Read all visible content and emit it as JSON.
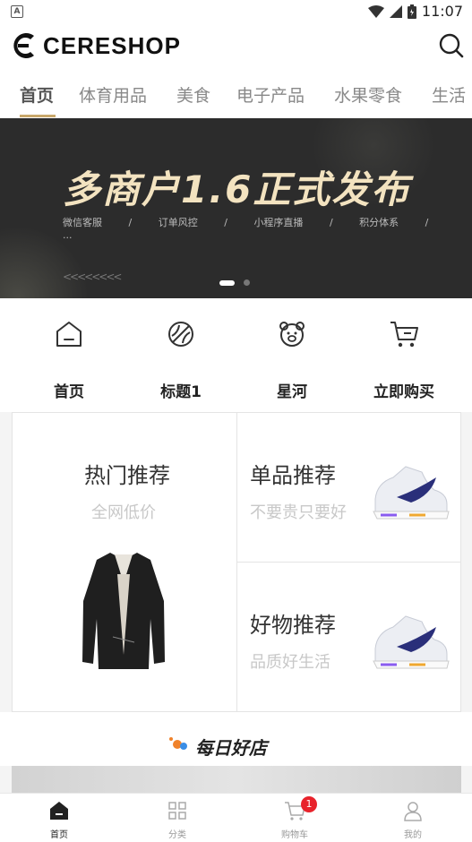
{
  "status_bar": {
    "time": "11:07",
    "app_icon_letter": "A"
  },
  "header": {
    "logo_text": "CERESHOP"
  },
  "tabs": [
    {
      "label": "首页",
      "active": true
    },
    {
      "label": "体育用品"
    },
    {
      "label": "美食"
    },
    {
      "label": "电子产品"
    },
    {
      "label": "水果零食"
    },
    {
      "label": "生活"
    }
  ],
  "banner": {
    "title": "多商户1.6正式发布",
    "features": [
      "微信客服",
      "/",
      "订单风控",
      "/",
      "小程序直播",
      "/",
      "积分体系",
      "/",
      "..."
    ],
    "arrows": "<<<<<<<<"
  },
  "nav_grid": [
    {
      "label": "首页",
      "icon": "home-icon"
    },
    {
      "label": "标题1",
      "icon": "ball-icon"
    },
    {
      "label": "星河",
      "icon": "bear-icon"
    },
    {
      "label": "立即购买",
      "icon": "cart-icon"
    }
  ],
  "promo": {
    "hot": {
      "title": "热门推荐",
      "subtitle": "全网低价"
    },
    "single": {
      "title": "单品推荐",
      "subtitle": "不要贵只要好"
    },
    "good": {
      "title": "好物推荐",
      "subtitle": "品质好生活"
    }
  },
  "shop_section": {
    "title": "每日好店"
  },
  "tabbar": [
    {
      "label": "首页",
      "icon": "home-icon",
      "active": true
    },
    {
      "label": "分类",
      "icon": "grid-icon"
    },
    {
      "label": "购物车",
      "icon": "cart-icon",
      "badge": "1"
    },
    {
      "label": "我的",
      "icon": "user-icon"
    }
  ],
  "colors": {
    "accent": "#c9a86b",
    "banner_bg": "#2c2c2c",
    "badge": "#e8222b"
  }
}
